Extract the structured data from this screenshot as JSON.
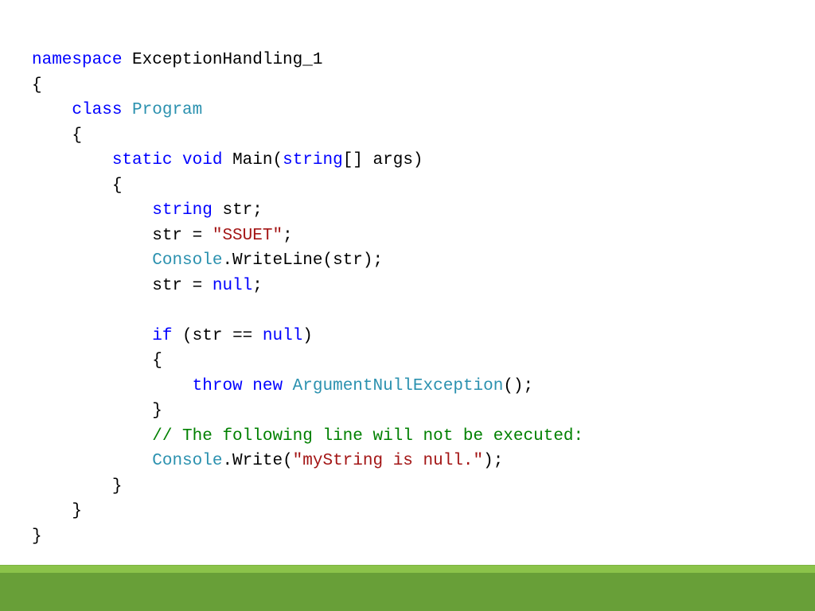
{
  "code": {
    "l1_kw": "namespace",
    "l1_name": " ExceptionHandling_1",
    "l2": "{",
    "l3_kw": "class",
    "l3_name": " Program",
    "l4": "    {",
    "l5_kw1": "static",
    "l5_kw2": " void",
    "l5_name": " Main(",
    "l5_type": "string",
    "l5_rest": "[] args)",
    "l6": "        {",
    "l7_type": "string",
    "l7_rest": " str;",
    "l8_pre": "            str = ",
    "l8_str": "\"SSUET\"",
    "l8_post": ";",
    "l9_cls": "Console",
    "l9_rest": ".WriteLine(str);",
    "l10_pre": "            str = ",
    "l10_kw": "null",
    "l10_post": ";",
    "l11_kw": "if",
    "l11_pre": " (str == ",
    "l11_null": "null",
    "l11_post": ")",
    "l12": "            {",
    "l13_kw1": "throw",
    "l13_kw2": " new",
    "l13_cls": " ArgumentNullException",
    "l13_rest": "();",
    "l14": "            }",
    "l15_comment": "// The following line will not be executed:",
    "l16_cls": "Console",
    "l16_mid": ".Write(",
    "l16_str": "\"myString is null.\"",
    "l16_post": ");",
    "l17": "        }",
    "l18": "    }",
    "l19": "}"
  }
}
